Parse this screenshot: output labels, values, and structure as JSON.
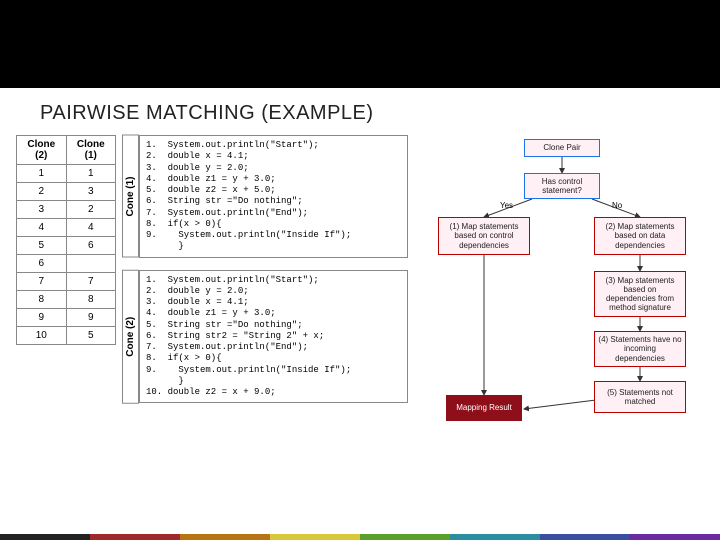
{
  "title": "PAIRWISE MATCHING (EXAMPLE)",
  "table": {
    "headers": [
      "Clone (2)",
      "Clone (1)"
    ],
    "rows": [
      [
        "1",
        "1"
      ],
      [
        "2",
        "3"
      ],
      [
        "3",
        "2"
      ],
      [
        "4",
        "4"
      ],
      [
        "5",
        "6"
      ],
      [
        "6",
        ""
      ],
      [
        "7",
        "7"
      ],
      [
        "8",
        "8"
      ],
      [
        "9",
        "9"
      ],
      [
        "10",
        "5"
      ]
    ]
  },
  "code1": {
    "label": "Cone (1)",
    "lines": [
      "1.  System.out.println(\"Start\");",
      "2.  double x = 4.1;",
      "3.  double y = 2.0;",
      "4.  double z1 = y + 3.0;",
      "5.  double z2 = x + 5.0;",
      "6.  String str =\"Do nothing\";",
      "7.  System.out.println(\"End\");",
      "8.  if(x > 0){",
      "9.    System.out.println(\"Inside If\");",
      "      }"
    ]
  },
  "code2": {
    "label": "Cone (2)",
    "lines": [
      "1.  System.out.println(\"Start\");",
      "2.  double y = 2.0;",
      "3.  double x = 4.1;",
      "4.  double z1 = y + 3.0;",
      "5.  String str =\"Do nothing\";",
      "6.  String str2 = \"String 2\" + x;",
      "7.  System.out.println(\"End\");",
      "8.  if(x > 0){",
      "9.    System.out.println(\"Inside If\");",
      "      }",
      "10. double z2 = x + 9.0;"
    ]
  },
  "flow": {
    "n_pair": "Clone Pair",
    "n_ctrl": "Has control statement?",
    "e_yes": "Yes",
    "e_no": "No",
    "n1": "(1) Map statements based on control dependencies",
    "n2": "(2) Map statements based on data dependencies",
    "n3": "(3) Map statements based on dependencies from method signature",
    "n4": "(4) Statements have no incoming dependencies",
    "n5": "(5) Statements not matched",
    "n_map": "Mapping Result"
  },
  "colors": {
    "segments": [
      "#222",
      "#a02a2a",
      "#b87313",
      "#d8c93a",
      "#5aa02a",
      "#2a8ea0",
      "#3b4fa0",
      "#6a2aa0"
    ]
  }
}
